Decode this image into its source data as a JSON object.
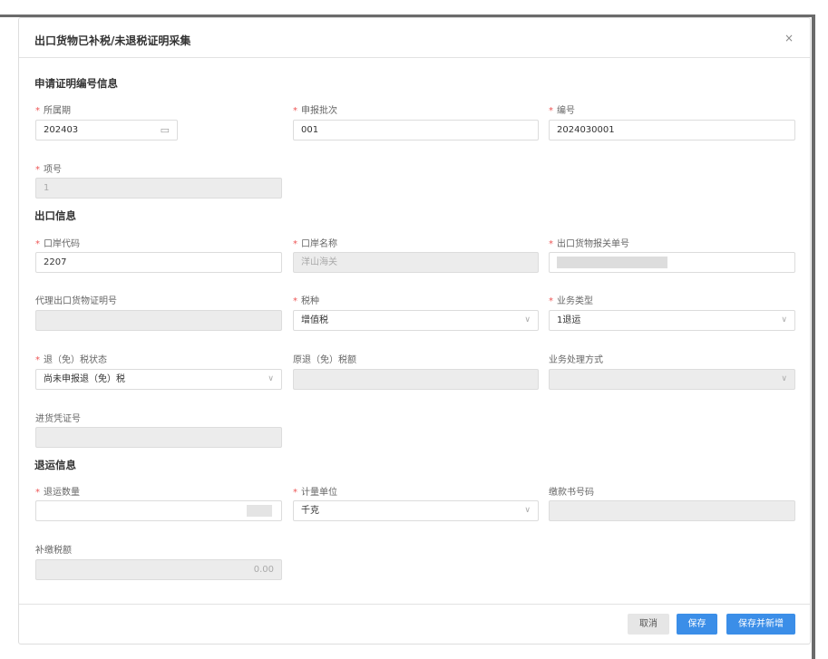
{
  "dialog": {
    "title": "出口货物已补税/未退税证明采集",
    "close_icon": "×"
  },
  "sections": {
    "apply": "申请证明编号信息",
    "export": "出口信息",
    "return": "退运信息"
  },
  "fields": {
    "period": {
      "label": "所属期",
      "value": "202403",
      "required": true
    },
    "batch": {
      "label": "申报批次",
      "value": "001",
      "required": true
    },
    "number": {
      "label": "编号",
      "value": "2024030001",
      "required": true
    },
    "item_no": {
      "label": "项号",
      "value": "1",
      "required": true
    },
    "port_code": {
      "label": "口岸代码",
      "value": "2207",
      "required": true
    },
    "port_name": {
      "label": "口岸名称",
      "value": "洋山海关",
      "required": true
    },
    "declaration_no": {
      "label": "出口货物报关单号",
      "value": "",
      "required": true
    },
    "agent_cert_no": {
      "label": "代理出口货物证明号",
      "value": ""
    },
    "tax_type": {
      "label": "税种",
      "value": "增值税",
      "required": true
    },
    "biz_type": {
      "label": "业务类型",
      "value": "1退运",
      "required": true
    },
    "refund_status": {
      "label": "退（免）税状态",
      "value": "尚未申报退（免）税",
      "required": true
    },
    "orig_refund": {
      "label": "原退（免）税额",
      "value": ""
    },
    "handling": {
      "label": "业务处理方式",
      "value": ""
    },
    "purchase_voucher": {
      "label": "进货凭证号",
      "value": ""
    },
    "return_qty": {
      "label": "退运数量",
      "value": "",
      "required": true
    },
    "unit": {
      "label": "计量单位",
      "value": "千克",
      "required": true
    },
    "payment_no": {
      "label": "缴款书号码",
      "value": ""
    },
    "supplement_tax": {
      "label": "补缴税额",
      "value": "0.00"
    }
  },
  "footer": {
    "cancel": "取消",
    "save": "保存",
    "save_new": "保存并新增"
  },
  "colors": {
    "primary": "#3b8ee8",
    "required": "#e55555"
  }
}
